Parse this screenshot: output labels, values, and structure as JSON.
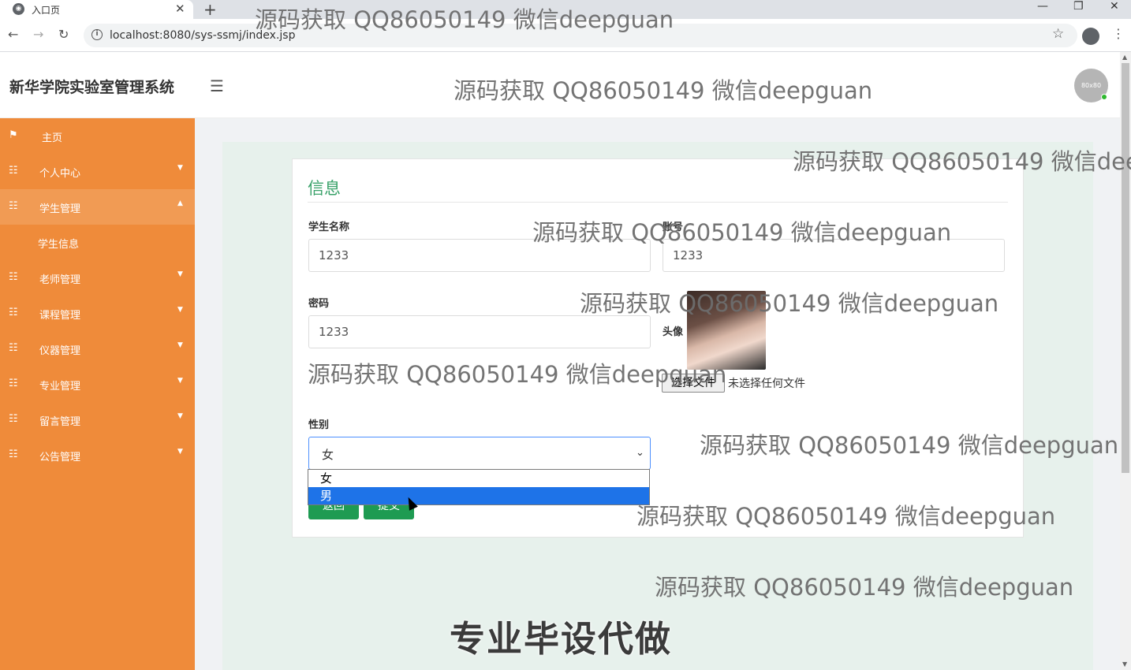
{
  "browser": {
    "tab_title": "入口页",
    "url": "localhost:8080/sys-ssmj/index.jsp",
    "tab_close": "✕",
    "new_tab": "+"
  },
  "header": {
    "title": "新华学院实验室管理系统",
    "avatar_text": "80x80"
  },
  "sidebar": {
    "items": [
      {
        "label": "主页",
        "icon": "flag-icon"
      },
      {
        "label": "个人中心",
        "icon": "grid-icon"
      },
      {
        "label": "学生管理",
        "icon": "grid-icon"
      },
      {
        "label": "老师管理",
        "icon": "grid-icon"
      },
      {
        "label": "课程管理",
        "icon": "grid-icon"
      },
      {
        "label": "仪器管理",
        "icon": "grid-icon"
      },
      {
        "label": "专业管理",
        "icon": "grid-icon"
      },
      {
        "label": "留言管理",
        "icon": "grid-icon"
      },
      {
        "label": "公告管理",
        "icon": "grid-icon"
      }
    ],
    "sub_item": "学生信息"
  },
  "form": {
    "title": "信息",
    "student_name_label": "学生名称",
    "student_name_value": "1233",
    "account_label": "账号",
    "account_value": "1233",
    "password_label": "密码",
    "password_value": "1233",
    "avatar_label": "头像",
    "file_button": "选择文件",
    "file_status": "未选择任何文件",
    "gender_label": "性别",
    "gender_value": "女",
    "gender_options": [
      "女",
      "男"
    ],
    "back_button": "返回",
    "submit_button": "提交"
  },
  "watermarks": {
    "text": "源码获取 QQ86050149 微信deepguan",
    "big_text": "专业毕设代做"
  }
}
